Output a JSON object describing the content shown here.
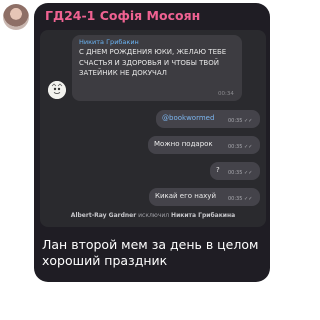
{
  "post": {
    "sender": "ГД24-1 Софія Мосоян",
    "caption": "Лан второй мем за день в целом хороший праздник"
  },
  "screenshot": {
    "incoming": {
      "name": "Никита Грибакин",
      "text": "С ДНЕМ РОЖДЕНИЯ ЮКИ, ЖЕЛАЮ ТЕБЕ СЧАСТЬЯ И ЗДОРОВЬЯ И ЧТОБЫ ТВОЙ ЗАТЕЙНИК НЕ ДОКУЧАЛ",
      "time": "00:34"
    },
    "outgoing": [
      {
        "text": "@bookwormed",
        "time": "00:35"
      },
      {
        "text": "Можно подарок",
        "time": "00:35"
      },
      {
        "text": "?",
        "time": "00:35"
      },
      {
        "text": "Кикай его нахуй",
        "time": "00:35"
      }
    ],
    "system": {
      "actor": "Albert-Ray Gardner",
      "action": "исключил",
      "target": "Никита Грибакина"
    }
  },
  "colors": {
    "bubble": "#1f1d24",
    "sender_name": "#f06292",
    "inner_name": "#6ab3f3",
    "outgoing_bubble": "#44434a"
  }
}
